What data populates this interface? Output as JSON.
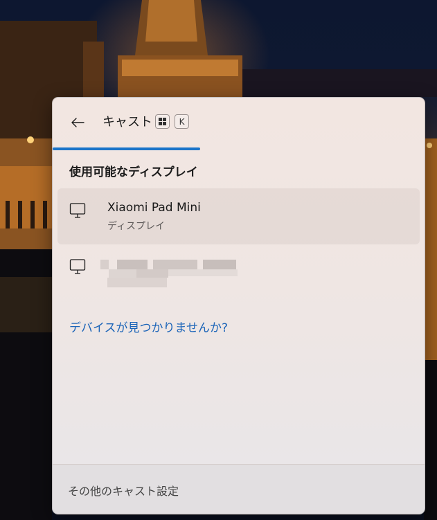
{
  "panel": {
    "title": "キャスト",
    "shortcut_keys": [
      "K"
    ],
    "section_title": "使用可能なディスプレイ",
    "devices": [
      {
        "name": "Xiaomi Pad Mini",
        "subtitle": "ディスプレイ",
        "icon": "monitor-icon",
        "selected": true
      },
      {
        "name": "",
        "subtitle": "",
        "icon": "monitor-icon",
        "selected": false,
        "redacted": true
      }
    ],
    "help_link": "デバイスが見つかりませんか?",
    "footer_link": "その他のキャスト設定"
  },
  "colors": {
    "accent": "#1a74c9",
    "link": "#1b64b8"
  }
}
